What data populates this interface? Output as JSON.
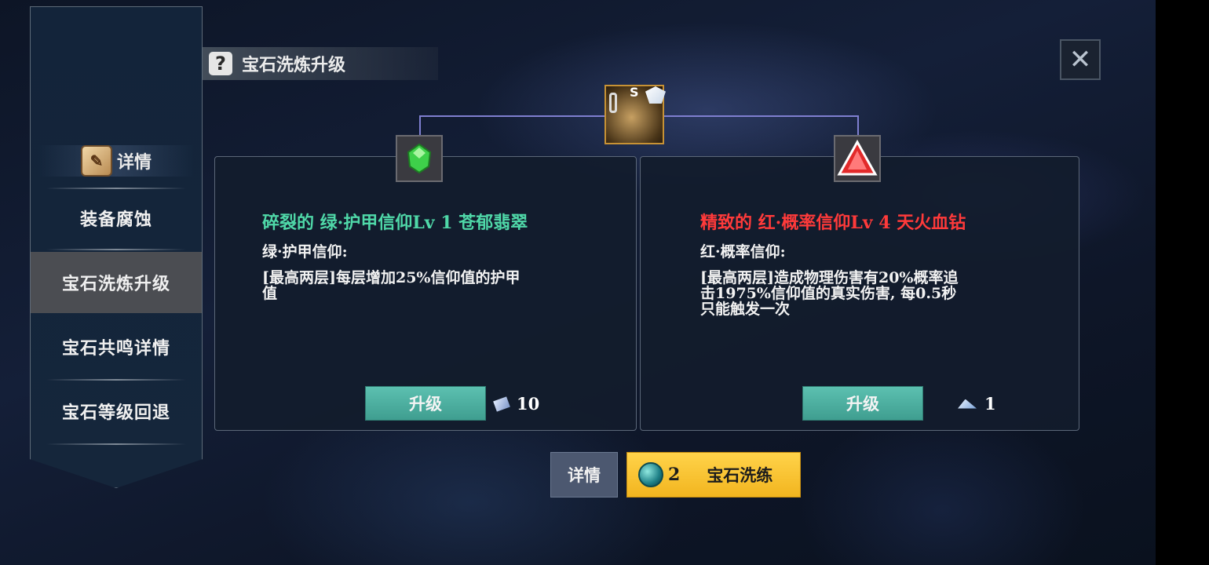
{
  "header": {
    "title": "宝石洗炼升级",
    "help_icon": "question-icon"
  },
  "sidebar": {
    "detail_label": "详情",
    "detail_icon": "scroll-icon",
    "items": [
      {
        "label": "装备腐蚀",
        "active": false
      },
      {
        "label": "宝石洗炼升级",
        "active": true
      },
      {
        "label": "宝石共鸣详情",
        "active": false
      },
      {
        "label": "宝石等级回退",
        "active": false
      }
    ]
  },
  "equipment": {
    "grade": "S",
    "icon": "armor-icon"
  },
  "gems": [
    {
      "title": "碎裂的 绿·护甲信仰Lv 1 苍郁翡翠",
      "title_color": "#4fd8a8",
      "subtitle": "绿·护甲信仰:",
      "desc_lines": [
        "[最高两层]每层增加25%信仰值的护甲",
        "值"
      ],
      "upgrade_label": "升级",
      "cost": "10",
      "cost_icon": "blue-shard-icon"
    },
    {
      "title": "精致的 红·概率信仰Lv 4 天火血钻",
      "title_color": "#ff3a3a",
      "subtitle": "红·概率信仰:",
      "desc_lines": [
        "[最高两层]造成物理伤害有20%概率追",
        "击1975%信仰值的真实伤害, 每0.5秒",
        "只能触发一次"
      ],
      "upgrade_label": "升级",
      "cost": "1",
      "cost_icon": "crystal-shard-icon"
    }
  ],
  "bottom": {
    "detail_label": "详情",
    "refine_count": "2",
    "refine_label": "宝石洗练"
  },
  "close_icon": "close-icon"
}
